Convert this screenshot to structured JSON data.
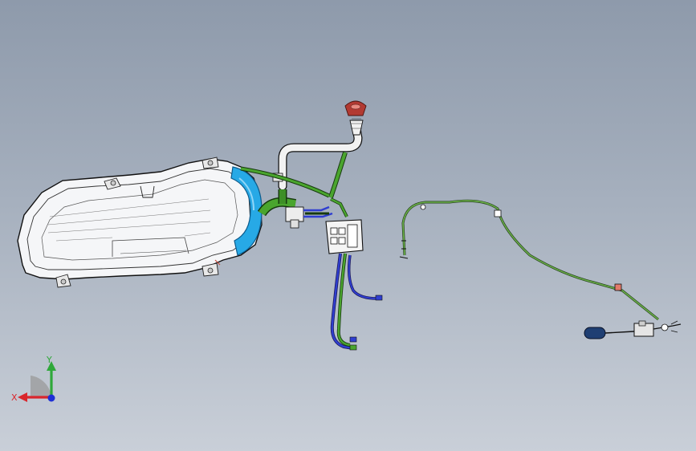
{
  "app": {
    "title": ""
  },
  "triad": {
    "x_label": "X",
    "y_label": "Y",
    "x_color": "#d9262c",
    "y_color": "#2fa83a",
    "z_color": "#1d2fd6"
  },
  "colors": {
    "background_top": "#8e9aab",
    "background_bottom": "#c9cfd8",
    "tank_body": "#f5f6f8",
    "tank_highlight": "#27a9e6",
    "fuel_hose": "#4aa52e",
    "vent_pipe": "#f2f2f2",
    "blue_line": "#2f3ed0",
    "filler_cap": "#b23a32",
    "cable": "#5a9a3c"
  },
  "model": {
    "components": [
      {
        "name": "fuel-tank"
      },
      {
        "name": "filler-neck"
      },
      {
        "name": "vent-pipe"
      },
      {
        "name": "evap-canister"
      },
      {
        "name": "fuel-lines"
      },
      {
        "name": "sender-cable"
      },
      {
        "name": "fuel-pump-assembly"
      }
    ]
  }
}
